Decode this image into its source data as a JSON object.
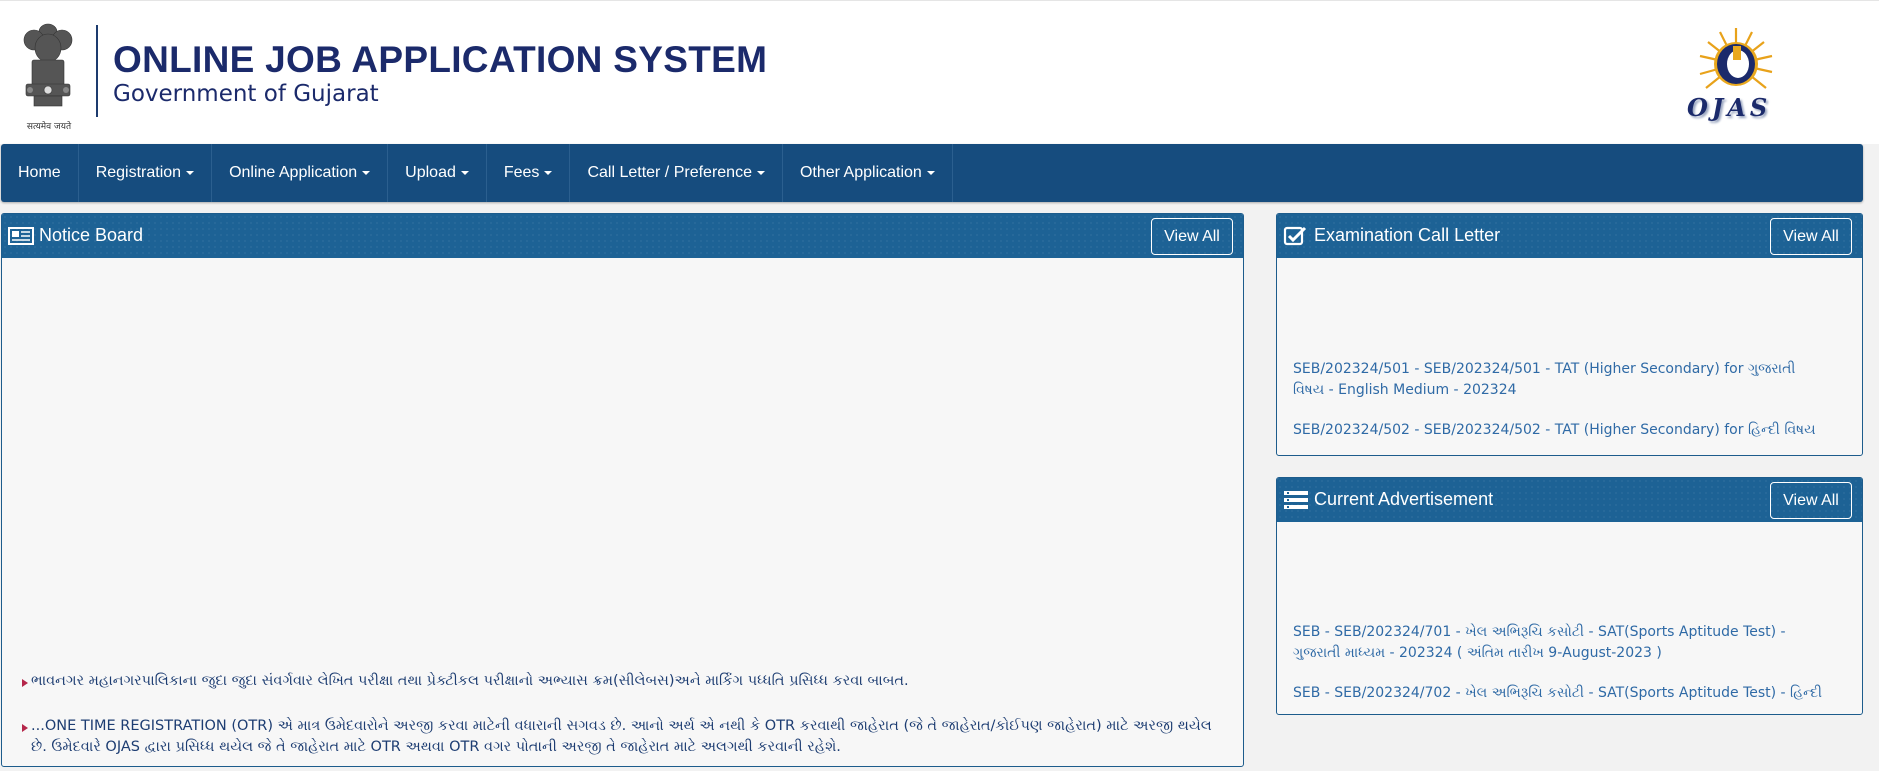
{
  "header": {
    "title": "ONLINE JOB APPLICATION SYSTEM",
    "subtitle": "Government of Gujarat",
    "emblem_caption": "सत्यमेव जयते",
    "logo_text": "OJAS"
  },
  "nav": {
    "items": [
      {
        "label": "Home",
        "dropdown": false
      },
      {
        "label": "Registration",
        "dropdown": true
      },
      {
        "label": "Online Application",
        "dropdown": true
      },
      {
        "label": "Upload",
        "dropdown": true
      },
      {
        "label": "Fees",
        "dropdown": true
      },
      {
        "label": "Call Letter / Preference",
        "dropdown": true
      },
      {
        "label": "Other Application",
        "dropdown": true
      }
    ]
  },
  "notice_board": {
    "title": "Notice Board",
    "view_all": "View All",
    "items": [
      "ભાવનગર મહાનગરપાલિકાના જુદા જુદા સંવર્ગવાર લેખિત પરીક્ષા તથા પ્રેક્ટીકલ પરીક્ષાનો અભ્યાસ ક્રમ(સીલેબસ)અને માર્કિંગ પધ્ધતિ પ્રસિધ્ધ કરવા બાબત.",
      "...ONE TIME REGISTRATION (OTR) એ માત્ર ઉમેદવારોને અરજી કરવા માટેની વધારાની સગવડ છે. આનો અર્થ એ નથી કે OTR કરવાથી જાહેરાત (જે તે જાહેરાત/કોઈપણ જાહેરાત) માટે અરજી થયેલ છે. ઉમેદવારે OJAS દ્વારા પ્રસિધ્ધ થયેલ જે તે જાહેરાત માટે OTR અથવા OTR વગર પોતાની અરજી તે જાહેરાત માટે અલગથી કરવાની રહેશે."
    ]
  },
  "call_letter": {
    "title": "Examination Call Letter",
    "view_all": "View All",
    "items": [
      "SEB/202324/501 - SEB/202324/501 - TAT (Higher Secondary) for ગુજરાતી વિષય - English Medium - 202324",
      "SEB/202324/502 - SEB/202324/502 - TAT (Higher Secondary) for હિન્દી વિષય"
    ]
  },
  "advertisement": {
    "title": "Current Advertisement",
    "view_all": "View All",
    "items": [
      "SEB - SEB/202324/701 - ખેલ અભિરૂચિ કસોટી - SAT(Sports Aptitude Test) - ગુજરાતી માધ્યમ - 202324 ( અંતિમ તારીખ 9-August-2023 )",
      "SEB - SEB/202324/702 - ખેલ અભિરૂચિ કસોટી - SAT(Sports Aptitude Test) - હિન્દી"
    ]
  },
  "colors": {
    "navbar": "#164c7e",
    "panel_header": "#1d6295",
    "title_text": "#1b2a6b",
    "link_text": "#2f6aa6",
    "bullet": "#b5264a"
  }
}
